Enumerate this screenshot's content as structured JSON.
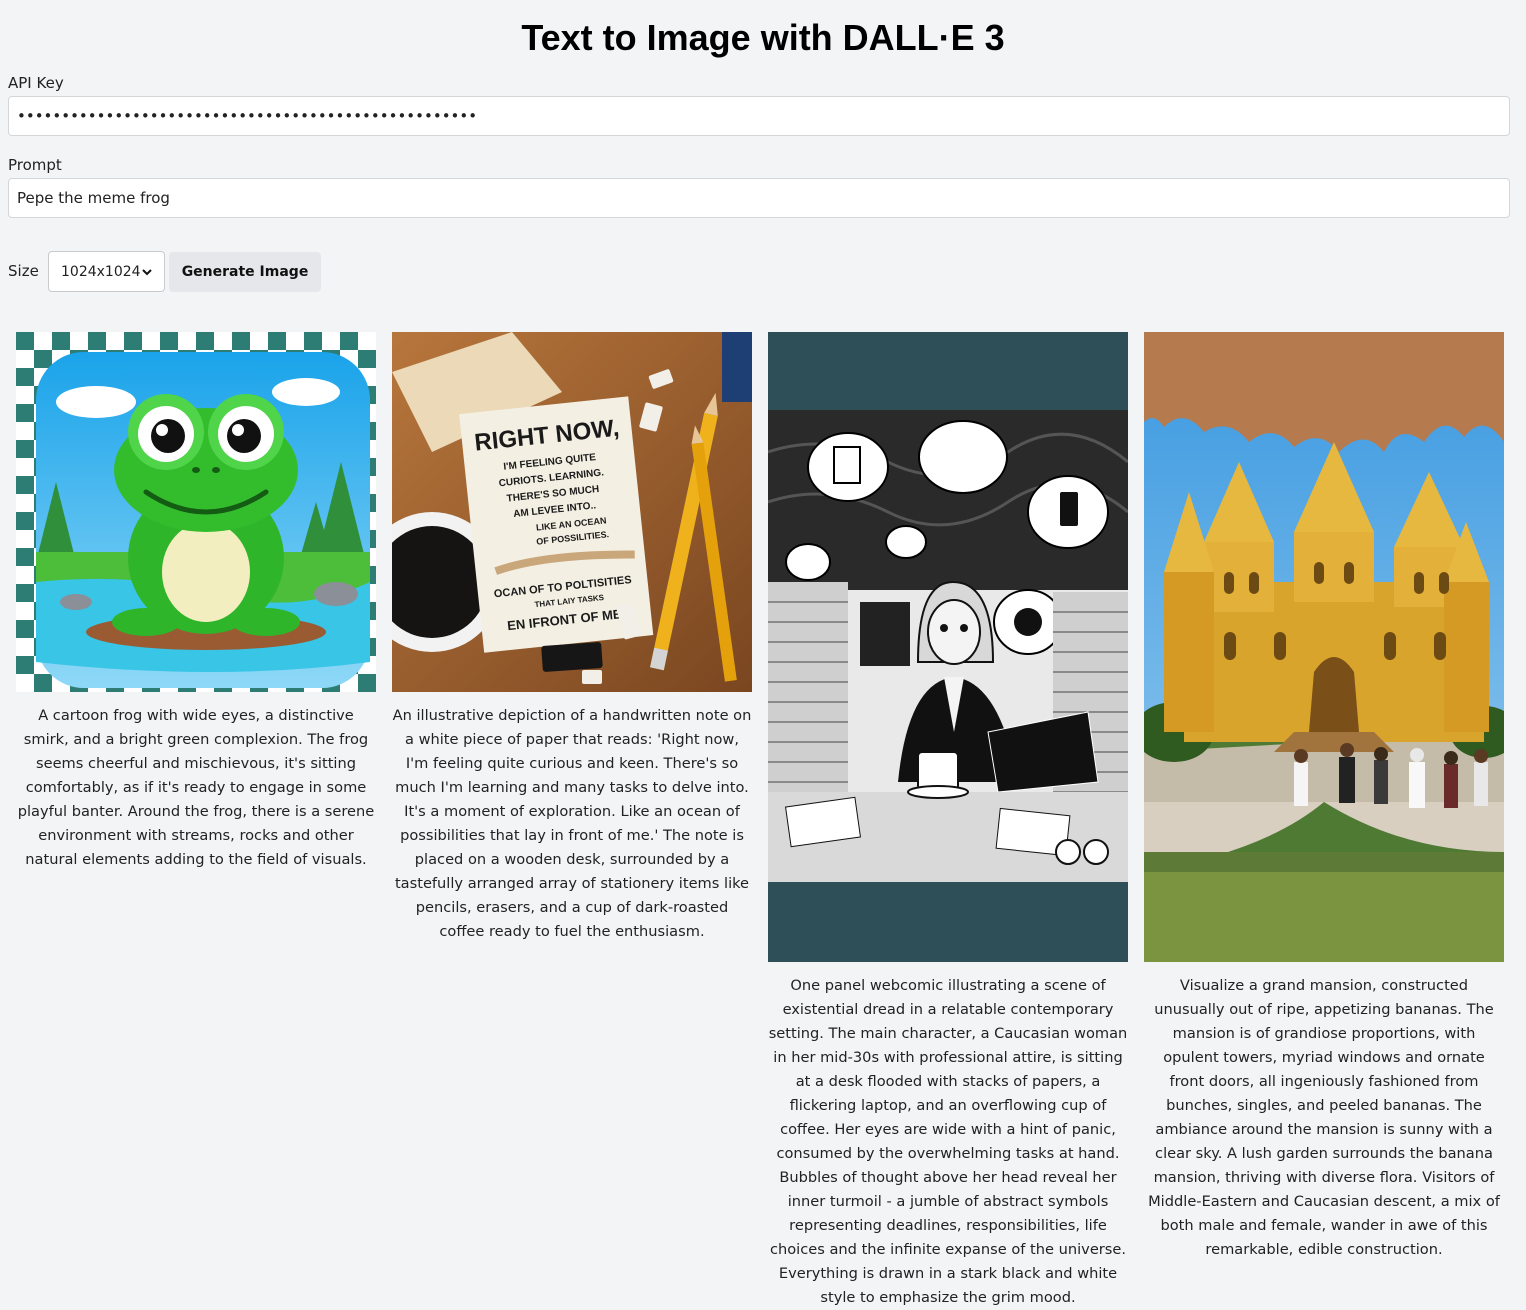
{
  "title": "Text to Image with DALL·E 3",
  "form": {
    "api_key_label": "API Key",
    "api_key_value": "••••••••••••••••••••••••••••••••••••••••••••••••••••",
    "prompt_label": "Prompt",
    "prompt_value": "Pepe the meme frog",
    "size_label": "Size",
    "size_selected": "1024x1024",
    "generate_label": "Generate Image"
  },
  "gallery": [
    {
      "caption": "A cartoon frog with wide eyes, a distinctive smirk, and a bright green complexion. The frog seems cheerful and mischievous, it's sitting comfortably, as if it's ready to engage in some playful banter. Around the frog, there is a serene environment with streams, rocks and other natural elements adding to the field of visuals."
    },
    {
      "caption": "An illustrative depiction of a handwritten note on a white piece of paper that reads: 'Right now, I'm feeling quite curious and keen. There's so much I'm learning and many tasks to delve into. It's a moment of exploration. Like an ocean of possibilities that lay in front of me.' The note is placed on a wooden desk, surrounded by a tastefully arranged array of stationery items like pencils, erasers, and a cup of dark-roasted coffee ready to fuel the enthusiasm.",
      "note_lines": [
        "RIGHT NOW,",
        "I'M FEELING QUITE",
        "CURIOTS. LEARNING.",
        "THERE'S SO MUCH",
        "AM LEVEE INTO..",
        "LIKE AN OCEAN",
        "OF POSSILITIES.",
        "OCAN OF TO POLTISITIES",
        "THAT LAIY TASKS",
        "EN IFRONT OF ME."
      ]
    },
    {
      "caption": "One panel webcomic illustrating a scene of existential dread in a relatable contemporary setting. The main character, a Caucasian woman in her mid-30s with professional attire, is sitting at a desk flooded with stacks of papers, a flickering laptop, and an overflowing cup of coffee. Her eyes are wide with a hint of panic, consumed by the overwhelming tasks at hand. Bubbles of thought above her head reveal her inner turmoil - a jumble of abstract symbols representing deadlines, responsibilities, life choices and the infinite expanse of the universe. Everything is drawn in a stark black and white style to emphasize the grim mood."
    },
    {
      "caption": "Visualize a grand mansion, constructed unusually out of ripe, appetizing bananas. The mansion is of grandiose proportions, with opulent towers, myriad windows and ornate front doors, all ingeniously fashioned from bunches, singles, and peeled bananas. The ambiance around the mansion is sunny with a clear sky. A lush garden surrounds the banana mansion, thriving with diverse flora. Visitors of Middle-Eastern and Caucasian descent, a mix of both male and female, wander in awe of this remarkable, edible construction."
    }
  ]
}
